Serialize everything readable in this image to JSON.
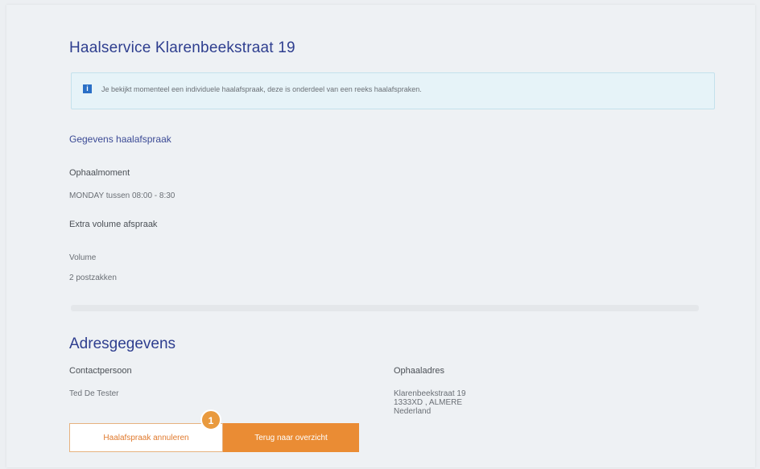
{
  "header": {
    "title": "Haalservice  Klarenbeekstraat  19"
  },
  "info": {
    "icon": "info-icon",
    "icon_glyph": "i",
    "message": "Je bekijkt momenteel een individuele haalafspraak, deze is onderdeel van een reeks haalafspraken."
  },
  "details": {
    "section_title": "Gegevens haalafspraak",
    "pickup_label": "Ophaalmoment",
    "pickup_value": "MONDAY  tussen  08:00 - 8:30",
    "extra_label": "Extra volume afspraak",
    "volume_label": "Volume",
    "volume_value": "2 postzakken"
  },
  "address": {
    "section_title": "Adresgegevens",
    "contact_label": "Contactpersoon",
    "contact_value": "Ted De Tester",
    "pickup_address_label": "Ophaaladres",
    "pickup_address_line1": "Klarenbeekstraat  19",
    "pickup_address_line2": "1333XD ,  ALMERE",
    "pickup_address_line3": "Nederland"
  },
  "actions": {
    "cancel_label": "Haalafspraak annuleren",
    "back_label": "Terug naar overzicht",
    "step_badge": "1"
  },
  "colors": {
    "title": "#2e3e8f",
    "accent_orange": "#ea8c34",
    "info_blue": "#2a6fc6"
  }
}
